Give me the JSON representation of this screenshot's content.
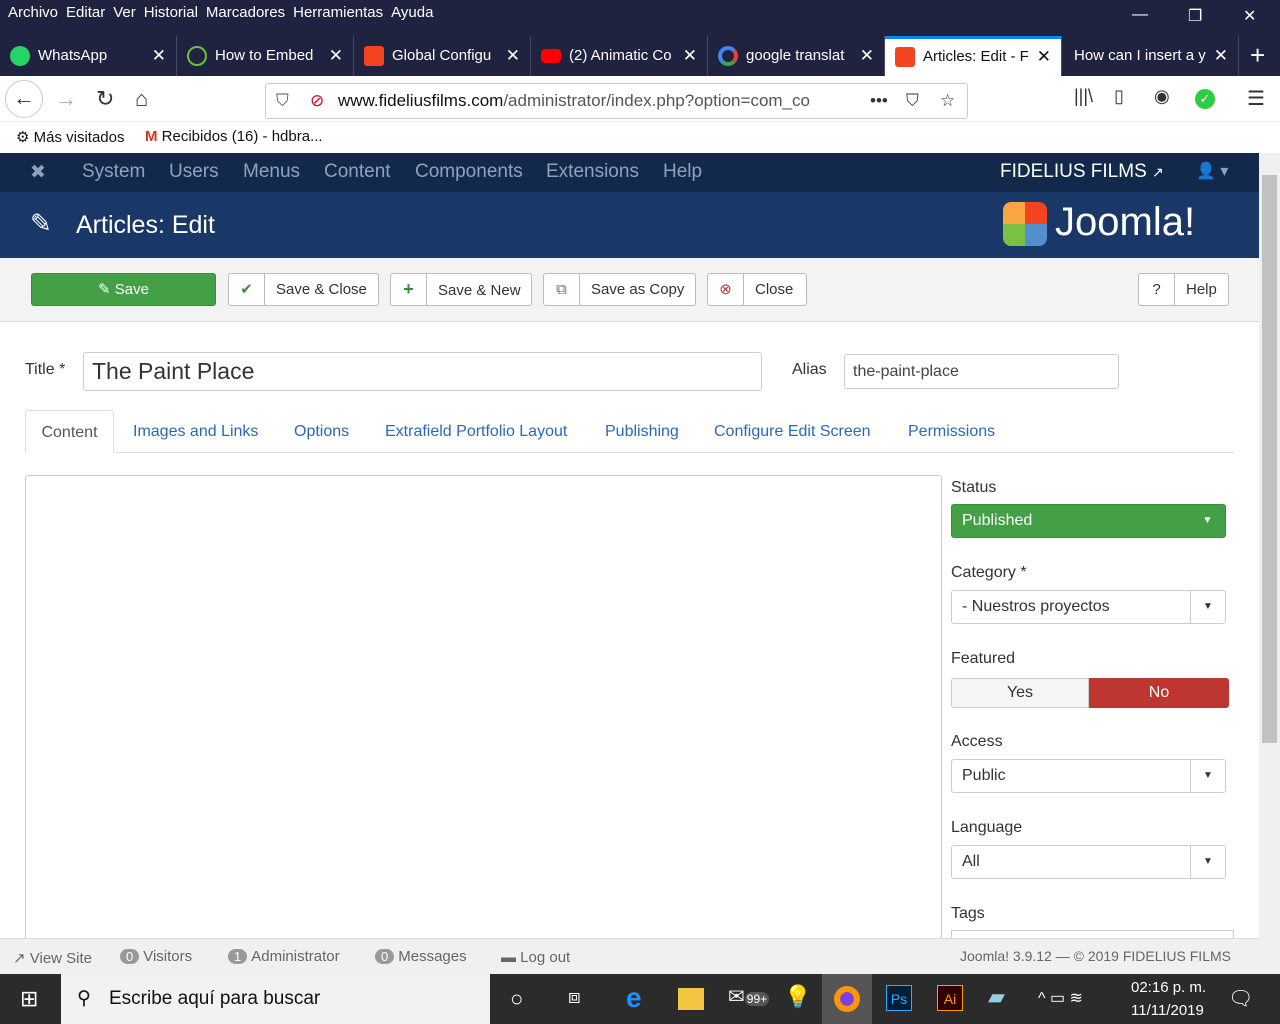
{
  "browser": {
    "menu": [
      "Archivo",
      "Editar",
      "Ver",
      "Historial",
      "Marcadores",
      "Herramientas",
      "Ayuda"
    ],
    "tabs": [
      {
        "title": "WhatsApp",
        "color": "#25d366"
      },
      {
        "title": "How to Embed",
        "color": "#6fbf3f"
      },
      {
        "title": "Global Configu",
        "color": "#f44321"
      },
      {
        "title": "(2) Animatic Co",
        "color": "#ff0000"
      },
      {
        "title": "google translat",
        "color": "#4285f4"
      },
      {
        "title": "Articles: Edit - F",
        "color": "#f44321"
      },
      {
        "title": "How can I insert a y",
        "color": "#1f2340"
      }
    ],
    "url_domain": "www.fideliusfilms.com",
    "url_path": "/administrator/index.php?option=com_co",
    "bookmarks": [
      "Más visitados",
      "Recibidos (16) - hdbra..."
    ]
  },
  "joomla": {
    "nav": [
      "System",
      "Users",
      "Menus",
      "Content",
      "Components",
      "Extensions",
      "Help"
    ],
    "site_name": "FIDELIUS FILMS",
    "page_title": "Articles: Edit",
    "logo_text": "Joomla!",
    "toolbar": {
      "save": "Save",
      "save_close": "Save & Close",
      "save_new": "Save & New",
      "save_copy": "Save as Copy",
      "close": "Close",
      "help": "Help"
    },
    "form": {
      "title_label": "Title *",
      "title_value": "The Paint Place",
      "alias_label": "Alias",
      "alias_value": "the-paint-place"
    },
    "tabs": [
      "Content",
      "Images and Links",
      "Options",
      "Extrafield Portfolio Layout",
      "Publishing",
      "Configure Edit Screen",
      "Permissions"
    ],
    "side": {
      "status_label": "Status",
      "status_value": "Published",
      "category_label": "Category *",
      "category_value": "- Nuestros proyectos",
      "featured_label": "Featured",
      "featured_yes": "Yes",
      "featured_no": "No",
      "access_label": "Access",
      "access_value": "Public",
      "language_label": "Language",
      "language_value": "All",
      "tags_label": "Tags"
    },
    "footer": {
      "view_site": "View Site",
      "visitors_count": "0",
      "visitors": "Visitors",
      "admin_count": "1",
      "admin": "Administrator",
      "messages_count": "0",
      "messages": "Messages",
      "logout": "Log out",
      "version": "Joomla! 3.9.12  —  © 2019 FIDELIUS FILMS"
    }
  },
  "taskbar": {
    "search_placeholder": "Escribe aquí para buscar",
    "time": "02:16 p. m.",
    "date": "11/11/2019",
    "mail_badge": "99+"
  }
}
